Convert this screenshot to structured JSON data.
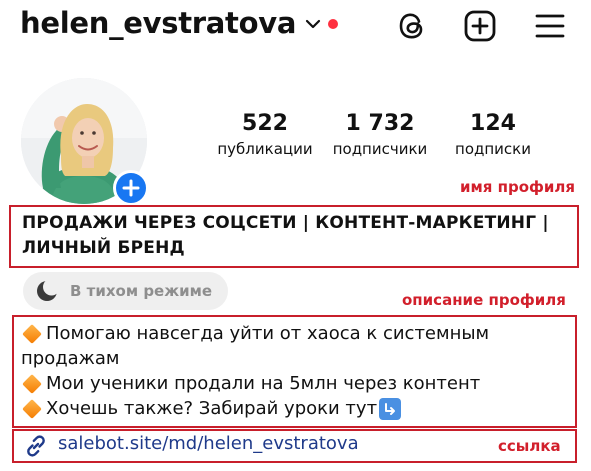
{
  "header": {
    "username": "helen_evstratova",
    "icons": [
      "chevron-down-icon",
      "threads-icon",
      "new-post-icon",
      "menu-icon"
    ],
    "notification_dot_color": "#ff3040"
  },
  "profile": {
    "stats": [
      {
        "value": "522",
        "label": "публикации"
      },
      {
        "value": "1 732",
        "label": "подписчики"
      },
      {
        "value": "124",
        "label": "подписки"
      }
    ],
    "name_line1": "ПРОДАЖИ ЧЕРЕЗ СОЦСЕТИ | КОНТЕНТ-МАРКЕТИНГ |",
    "name_line2": "ЛИЧНЫЙ БРЕНД",
    "quiet_mode": "В тихом режиме",
    "bio": [
      "Помогаю навсегда уйти от хаоса к системным",
      "продажам",
      "Мои ученики продали на 5млн через контент",
      "Хочешь также? Забирай уроки тут"
    ],
    "link": "salebot.site/md/helen_evstratova"
  },
  "annotations": {
    "name_label": "имя профиля",
    "bio_label": "описание профиля",
    "link_label": "ссылка",
    "color": "#c81f2b"
  },
  "colors": {
    "accent_blue": "#1877f2",
    "link_color": "#1f3a8a"
  }
}
